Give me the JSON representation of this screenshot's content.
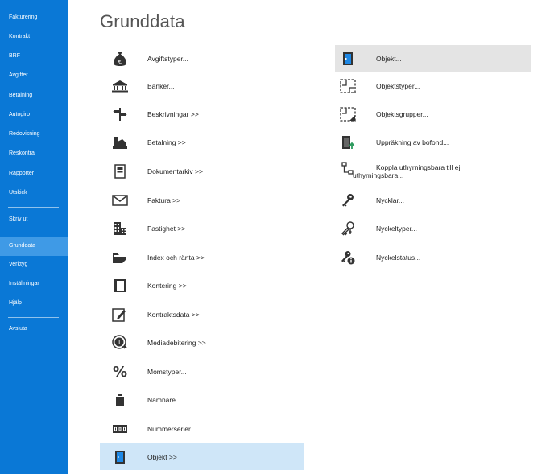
{
  "sidebar": {
    "items": [
      {
        "label": "Fakturering"
      },
      {
        "label": "Kontrakt"
      },
      {
        "label": "BRF"
      },
      {
        "label": "Avgifter"
      },
      {
        "label": "Betalning"
      },
      {
        "label": "Autogiro"
      },
      {
        "label": "Redovisning"
      },
      {
        "label": "Reskontra"
      },
      {
        "label": "Rapporter"
      },
      {
        "label": "Utskick"
      },
      {
        "label": "Skriv ut"
      },
      {
        "label": "Grunddata"
      },
      {
        "label": "Verktyg"
      },
      {
        "label": "Inställningar"
      },
      {
        "label": "Hjälp"
      },
      {
        "label": "Avsluta"
      }
    ],
    "active": "Grunddata",
    "color": "#0a78d6"
  },
  "main": {
    "title": "Grunddata",
    "left_items": [
      {
        "label": "Avgiftstyper...",
        "icon": "money-bag-icon"
      },
      {
        "label": "Banker...",
        "icon": "bank-icon"
      },
      {
        "label": "Beskrivningar >>",
        "icon": "signpost-icon"
      },
      {
        "label": "Betalning >>",
        "icon": "payment-icon"
      },
      {
        "label": "Dokumentarkiv >>",
        "icon": "document-archive-icon"
      },
      {
        "label": "Faktura >>",
        "icon": "envelope-icon"
      },
      {
        "label": "Fastighet >>",
        "icon": "building-icon"
      },
      {
        "label": "Index och ränta >>",
        "icon": "folder-chart-icon"
      },
      {
        "label": "Kontering >>",
        "icon": "ledger-book-icon"
      },
      {
        "label": "Kontraktsdata >>",
        "icon": "contract-edit-icon"
      },
      {
        "label": "Mediadebitering >>",
        "icon": "media-debit-icon"
      },
      {
        "label": "Momstyper...",
        "icon": "percent-icon"
      },
      {
        "label": "Nämnare...",
        "icon": "weight-icon"
      },
      {
        "label": "Nummerserier...",
        "icon": "number-series-icon"
      },
      {
        "label": "Objekt >>",
        "icon": "door-icon"
      }
    ],
    "right_items": [
      {
        "label": "Objekt...",
        "icon": "door-icon"
      },
      {
        "label": "Objektstyper...",
        "icon": "floorplan-icon"
      },
      {
        "label": "Objektsgrupper...",
        "icon": "floorplan-group-icon"
      },
      {
        "label": "Uppräkning av bofond...",
        "icon": "door-up-icon"
      },
      {
        "label": "Koppla uthyrningsbara till ej",
        "label2": "uthyrningsbara...",
        "icon": "hierarchy-icon"
      },
      {
        "label": "Nycklar...",
        "icon": "key-icon"
      },
      {
        "label": "Nyckeltyper...",
        "icon": "keys-icon"
      },
      {
        "label": "Nyckelstatus...",
        "icon": "key-info-icon"
      }
    ]
  }
}
